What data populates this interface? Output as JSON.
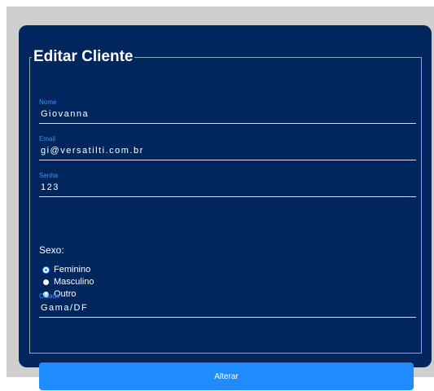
{
  "form": {
    "title": "Editar Cliente",
    "fields": {
      "nome": {
        "label": "Nome",
        "value": "Giovanna"
      },
      "email": {
        "label": "Email",
        "value": "gi@versatilti.com.br"
      },
      "senha": {
        "label": "Senha",
        "value": "123"
      },
      "cidade": {
        "label": "Cidade",
        "value": "Gama/DF"
      }
    },
    "sexo": {
      "label": "Sexo:",
      "options": [
        {
          "label": "Feminino",
          "checked": true
        },
        {
          "label": "Masculino",
          "checked": false
        },
        {
          "label": "Outro",
          "checked": false
        }
      ]
    },
    "submit_label": "Alterar"
  },
  "colors": {
    "page_background": "#cfcfcf",
    "card_background": "#00265e",
    "label_color": "#2f95ff",
    "button_color": "#1e8bff",
    "text_color": "#ffffff"
  }
}
